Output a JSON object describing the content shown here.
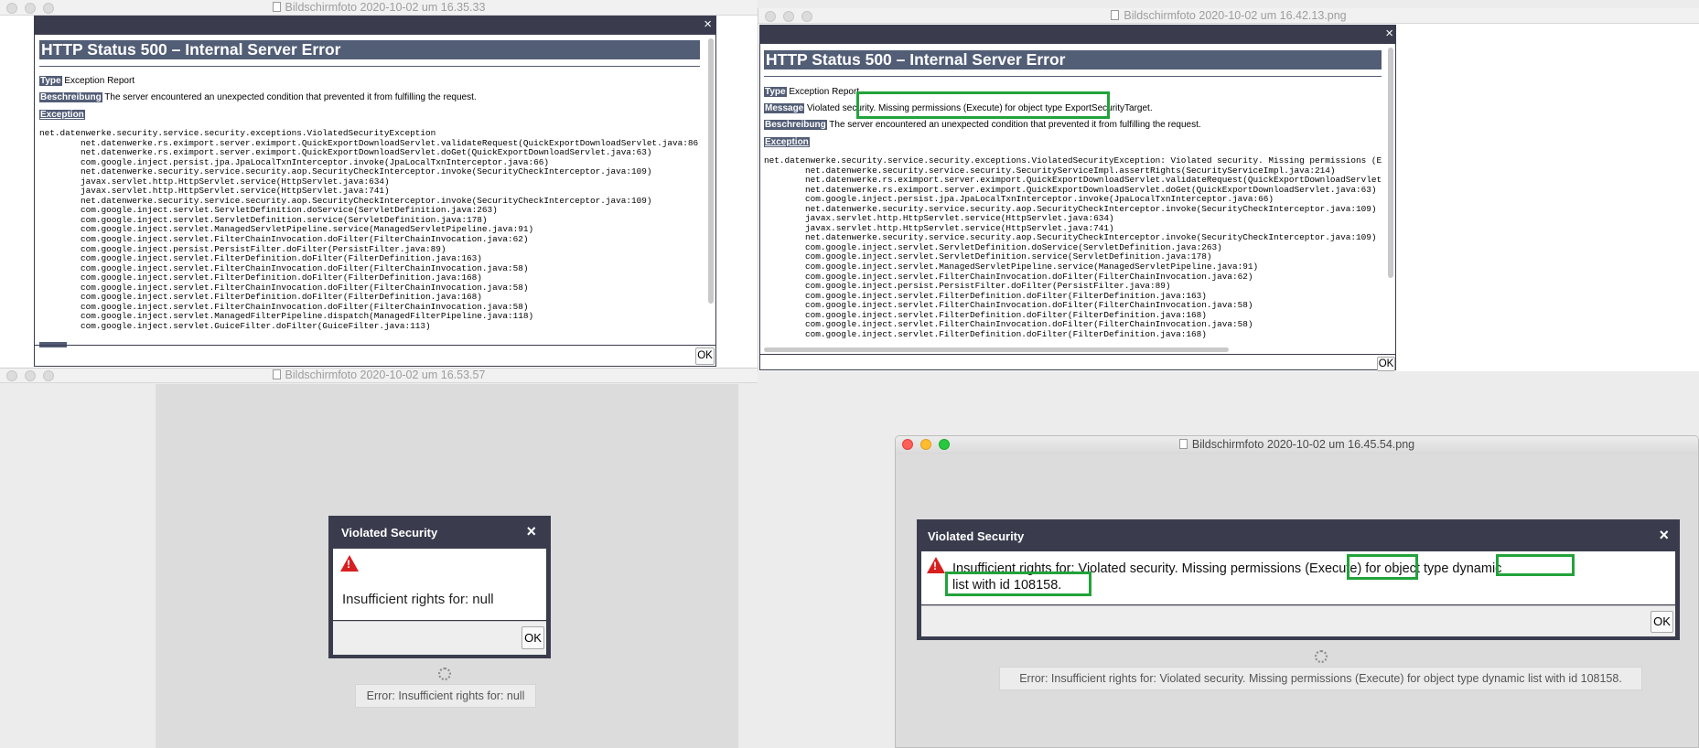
{
  "windows": [
    {
      "title": "Bildschirmfoto 2020-10-02 um 16.35.33",
      "http": {
        "heading": "HTTP Status 500 – Internal Server Error",
        "type_label": "Type",
        "type_value": "Exception Report",
        "desc_label": "Beschreibung",
        "desc_value": "The server encountered an unexpected condition that prevented it from fulfilling the request.",
        "exception_label": "Exception",
        "trace": "net.datenwerke.security.service.security.exceptions.ViolatedSecurityException\n\tnet.datenwerke.rs.eximport.server.eximport.QuickExportDownloadServlet.validateRequest(QuickExportDownloadServlet.java:86)\n\tnet.datenwerke.rs.eximport.server.eximport.QuickExportDownloadServlet.doGet(QuickExportDownloadServlet.java:63)\n\tcom.google.inject.persist.jpa.JpaLocalTxnInterceptor.invoke(JpaLocalTxnInterceptor.java:66)\n\tnet.datenwerke.security.service.security.aop.SecurityCheckInterceptor.invoke(SecurityCheckInterceptor.java:109)\n\tjavax.servlet.http.HttpServlet.service(HttpServlet.java:634)\n\tjavax.servlet.http.HttpServlet.service(HttpServlet.java:741)\n\tnet.datenwerke.security.service.security.aop.SecurityCheckInterceptor.invoke(SecurityCheckInterceptor.java:109)\n\tcom.google.inject.servlet.ServletDefinition.doService(ServletDefinition.java:263)\n\tcom.google.inject.servlet.ServletDefinition.service(ServletDefinition.java:178)\n\tcom.google.inject.servlet.ManagedServletPipeline.service(ManagedServletPipeline.java:91)\n\tcom.google.inject.servlet.FilterChainInvocation.doFilter(FilterChainInvocation.java:62)\n\tcom.google.inject.persist.PersistFilter.doFilter(PersistFilter.java:89)\n\tcom.google.inject.servlet.FilterDefinition.doFilter(FilterDefinition.java:163)\n\tcom.google.inject.servlet.FilterChainInvocation.doFilter(FilterChainInvocation.java:58)\n\tcom.google.inject.servlet.FilterDefinition.doFilter(FilterDefinition.java:168)\n\tcom.google.inject.servlet.FilterChainInvocation.doFilter(FilterChainInvocation.java:58)\n\tcom.google.inject.servlet.FilterDefinition.doFilter(FilterDefinition.java:168)\n\tcom.google.inject.servlet.FilterChainInvocation.doFilter(FilterChainInvocation.java:58)\n\tcom.google.inject.servlet.ManagedFilterPipeline.dispatch(ManagedFilterPipeline.java:118)\n\tcom.google.inject.servlet.GuiceFilter.doFilter(GuiceFilter.java:113)"
      },
      "ok_label": "OK",
      "close_glyph": "×"
    },
    {
      "title": "Bildschirmfoto 2020-10-02 um 16.42.13.png",
      "http": {
        "heading": "HTTP Status 500 – Internal Server Error",
        "type_label": "Type",
        "type_value": "Exception Report",
        "message_label": "Message",
        "message_prefix": "Violated security.",
        "message_highlight": "Missing permissions (Execute) for object type ExportSecurityTarget.",
        "desc_label": "Beschreibung",
        "desc_value": "The server encountered an unexpected condition that prevented it from fulfilling the request.",
        "exception_label": "Exception",
        "trace": "net.datenwerke.security.service.security.exceptions.ViolatedSecurityException: Violated security. Missing permissions (Execute) for object type ExportSecurityTarget.\n\tnet.datenwerke.security.service.security.SecurityServiceImpl.assertRights(SecurityServiceImpl.java:214)\n\tnet.datenwerke.rs.eximport.server.eximport.QuickExportDownloadServlet.validateRequest(QuickExportDownloadServlet.java:86)\n\tnet.datenwerke.rs.eximport.server.eximport.QuickExportDownloadServlet.doGet(QuickExportDownloadServlet.java:63)\n\tcom.google.inject.persist.jpa.JpaLocalTxnInterceptor.invoke(JpaLocalTxnInterceptor.java:66)\n\tnet.datenwerke.security.service.security.aop.SecurityCheckInterceptor.invoke(SecurityCheckInterceptor.java:109)\n\tjavax.servlet.http.HttpServlet.service(HttpServlet.java:634)\n\tjavax.servlet.http.HttpServlet.service(HttpServlet.java:741)\n\tnet.datenwerke.security.service.security.aop.SecurityCheckInterceptor.invoke(SecurityCheckInterceptor.java:109)\n\tcom.google.inject.servlet.ServletDefinition.doService(ServletDefinition.java:263)\n\tcom.google.inject.servlet.ServletDefinition.service(ServletDefinition.java:178)\n\tcom.google.inject.servlet.ManagedServletPipeline.service(ManagedServletPipeline.java:91)\n\tcom.google.inject.servlet.FilterChainInvocation.doFilter(FilterChainInvocation.java:62)\n\tcom.google.inject.persist.PersistFilter.doFilter(PersistFilter.java:89)\n\tcom.google.inject.servlet.FilterDefinition.doFilter(FilterDefinition.java:163)\n\tcom.google.inject.servlet.FilterChainInvocation.doFilter(FilterChainInvocation.java:58)\n\tcom.google.inject.servlet.FilterDefinition.doFilter(FilterDefinition.java:168)\n\tcom.google.inject.servlet.FilterChainInvocation.doFilter(FilterChainInvocation.java:58)\n\tcom.google.inject.servlet.FilterDefinition.doFilter(FilterDefinition.java:168)"
      },
      "ok_label": "OK",
      "close_glyph": "×",
      "highlight_color": "#22a33b"
    },
    {
      "title": "Bildschirmfoto 2020-10-02 um 16.53.57",
      "dialog": {
        "title": "Violated Security",
        "message": "Insufficient rights for: null",
        "ok_label": "OK",
        "close_glyph": "×"
      },
      "error_text": "Error: Insufficient rights for: null"
    },
    {
      "title": "Bildschirmfoto 2020-10-02 um 16.45.54.png",
      "dialog": {
        "title": "Violated Security",
        "msg_part1": "Insufficient rights for: Violated security. Missing permissions ",
        "msg_execute": "(Execute)",
        "msg_part2": " for object type ",
        "msg_dynamic": "dynamic",
        "msg_line2": "list with id 108158.",
        "ok_label": "OK",
        "close_glyph": "×"
      },
      "error_text": "Error: Insufficient rights for: Violated security. Missing permissions (Execute) for object type dynamic list with id 108158.",
      "highlight_color": "#22a33b"
    }
  ]
}
